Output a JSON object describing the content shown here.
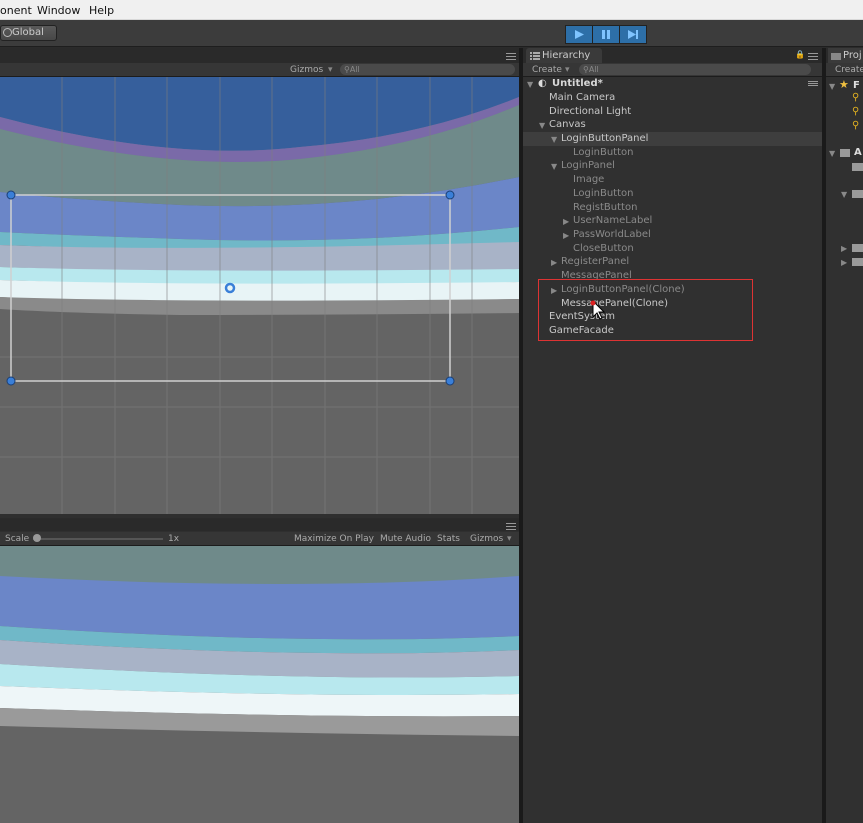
{
  "menu": {
    "component": "onent",
    "window": "Window",
    "help": "Help"
  },
  "toolbar": {
    "global_label": "Global"
  },
  "scene": {
    "gizmos_label": "Gizmos",
    "search_placeholder": "All"
  },
  "game": {
    "scale_label": "Scale",
    "scale_value": "1x",
    "maximize_label": "Maximize On Play",
    "mute_label": "Mute Audio",
    "stats_label": "Stats",
    "gizmos_label": "Gizmos"
  },
  "hierarchy": {
    "tab_label": "Hierarchy",
    "create_label": "Create",
    "search_placeholder": "All",
    "scene_name": "Untitled*",
    "items": [
      {
        "label": "Main Camera"
      },
      {
        "label": "Directional Light"
      },
      {
        "label": "Canvas"
      },
      {
        "label": "LoginButtonPanel"
      },
      {
        "label": "LoginButton"
      },
      {
        "label": "LoginPanel"
      },
      {
        "label": "Image"
      },
      {
        "label": "LoginButton"
      },
      {
        "label": "RegistButton"
      },
      {
        "label": "UserNameLabel"
      },
      {
        "label": "PassWorldLabel"
      },
      {
        "label": "CloseButton"
      },
      {
        "label": "RegisterPanel"
      },
      {
        "label": "MessagePanel"
      },
      {
        "label": "LoginButtonPanel(Clone)"
      },
      {
        "label": "MessagePanel(Clone)"
      },
      {
        "label": "EventSystem"
      },
      {
        "label": "GameFacade"
      }
    ]
  },
  "project": {
    "tab_label": "Proj",
    "create_label": "Create",
    "favorites_initial": "F",
    "assets_initial": "A"
  },
  "colors": {
    "accent_play": "#2d6fa8",
    "selection_box": "#dd3333"
  }
}
